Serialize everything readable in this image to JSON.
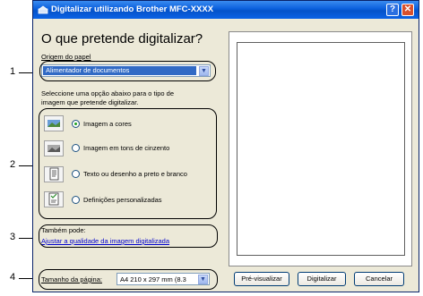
{
  "window": {
    "title": "Digitalizar utilizando Brother MFC-XXXX",
    "help_glyph": "?",
    "close_glyph": "✕"
  },
  "main": {
    "question": "O que pretende digitalizar?",
    "source_label": "Origem do papel",
    "source_value": "Alimentador de documentos",
    "instruction_line1": "Seleccione uma opção abaixo para o tipo de",
    "instruction_line2": "imagem que pretende digitalizar.",
    "options": [
      {
        "label": "Imagem a cores",
        "selected": true
      },
      {
        "label": "Imagem em tons de cinzento",
        "selected": false
      },
      {
        "label": "Texto ou desenho a preto e branco",
        "selected": false
      },
      {
        "label": "Definições personalizadas",
        "selected": false
      }
    ],
    "also_label": "Também pode:",
    "adjust_link": "Ajustar a qualidade da imagem digitalizada",
    "page_size_label": "Tamanho da página:",
    "page_size_value": "A4 210 x 297 mm (8.3"
  },
  "buttons": {
    "preview": "Pré-visualizar",
    "scan": "Digitalizar",
    "cancel": "Cancelar"
  },
  "callouts": [
    "1",
    "2",
    "3",
    "4"
  ],
  "icons": {
    "source": "scanner-icon",
    "color": "color-photo-icon",
    "gray": "grayscale-photo-icon",
    "text": "text-document-icon",
    "custom": "custom-settings-icon"
  },
  "colors": {
    "titlebar": "#0a5fdc",
    "dialog_bg": "#ece9d8",
    "link": "#0000cc",
    "radio_dot": "#21a121"
  }
}
